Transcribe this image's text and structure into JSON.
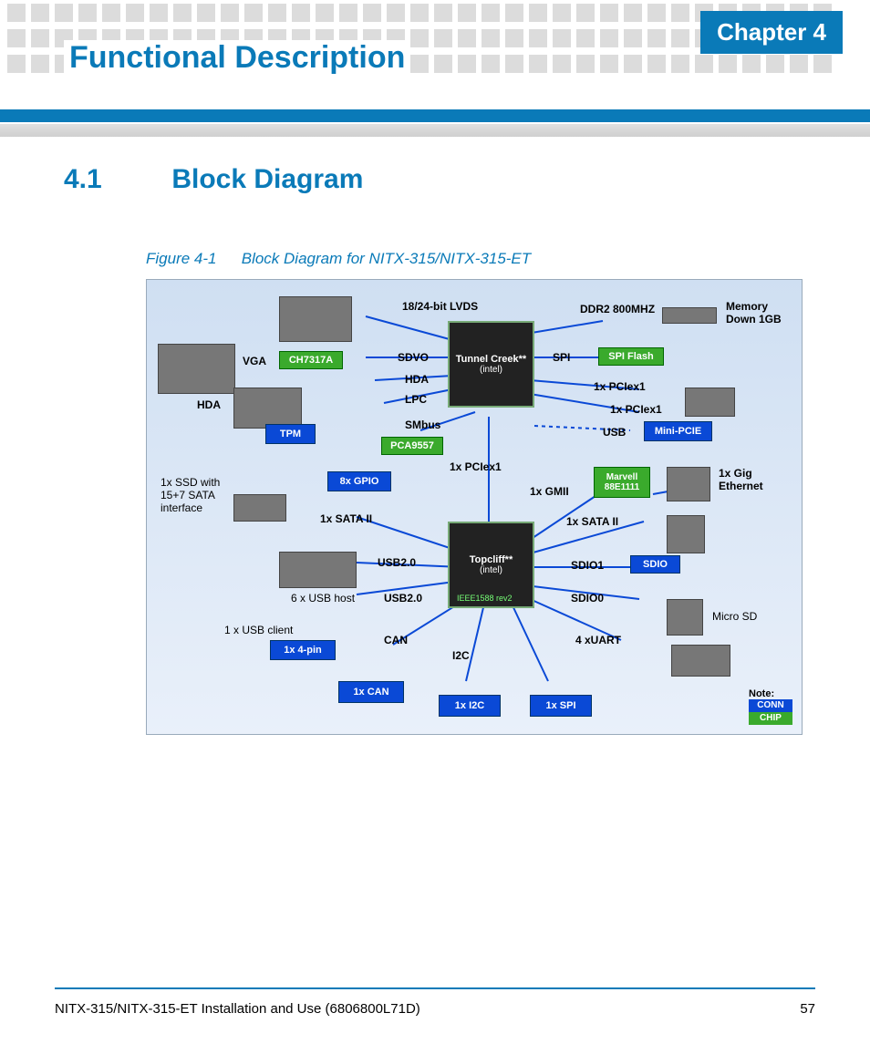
{
  "header": {
    "chapter_badge": "Chapter 4",
    "chapter_title": "Functional Description"
  },
  "section": {
    "number": "4.1",
    "title": "Block Diagram"
  },
  "figure": {
    "label": "Figure 4-1",
    "caption": "Block Diagram for NITX-315/NITX-315-ET"
  },
  "diagram": {
    "chips": {
      "tunnel_creek": "Tunnel Creek**",
      "topcliff": "Topcliff**",
      "intel_logo": "(intel)",
      "ieee1588": "IEEE1588 rev2",
      "ch7317a": "CH7317A",
      "pca9557": "PCA9557",
      "spi_flash": "SPI Flash",
      "marvell": "Marvell 88E1111",
      "tpm": "TPM",
      "mini_pcie": "Mini-PCIE",
      "sdio": "SDIO",
      "gpio_8x": "8x GPIO",
      "pin_1x4": "1x 4-pin",
      "can_1x": "1x CAN",
      "i2c_1x": "1x I2C",
      "spi_1x": "1x SPI"
    },
    "labels": {
      "lvds": "18/24-bit LVDS",
      "ddr2": "DDR2 800MHZ",
      "memory_down": "Memory Down 1GB",
      "vga": "VGA",
      "sdvo": "SDVO",
      "spi": "SPI",
      "hda": "HDA",
      "lpc": "LPC",
      "pciex1_a": "1x PCIex1",
      "pciex1_b": "1x PCIex1",
      "smbus": "SMbus",
      "usb": "USB",
      "pciex1_c": "1x PCIex1",
      "gmii_1x": "1x GMII",
      "gig_eth": "1x Gig Ethernet",
      "ssd_sata": "1x SSD with 15+7 SATA interface",
      "sata_ii_a": "1x SATA II",
      "sata_ii_b": "1x SATA II",
      "usb20_a": "USB2.0",
      "usb20_b": "USB2.0",
      "usb_host_6x": "6 x USB host",
      "usb_client_1x": "1 x USB client",
      "sdio1": "SDIO1",
      "sdio0": "SDIO0",
      "can": "CAN",
      "i2c": "I2C",
      "uart_4x": "4 xUART",
      "micro_sd": "Micro SD",
      "note_title": "Note:",
      "note_conn": "CONN",
      "note_chip": "CHIP"
    }
  },
  "footer": {
    "doc_title": "NITX-315/NITX-315-ET Installation and Use (6806800L71D)",
    "page_number": "57"
  }
}
